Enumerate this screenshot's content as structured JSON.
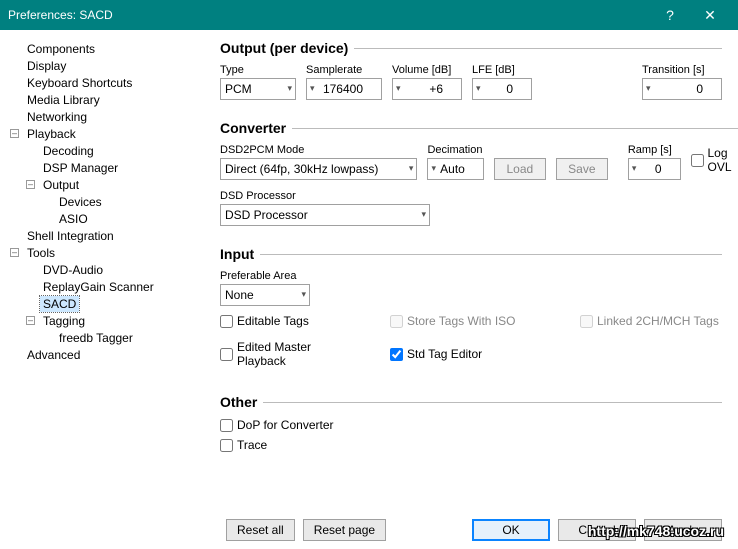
{
  "titlebar": {
    "title": "Preferences: SACD"
  },
  "tree": {
    "components": "Components",
    "display": "Display",
    "keyboard": "Keyboard Shortcuts",
    "media": "Media Library",
    "networking": "Networking",
    "playback": "Playback",
    "decoding": "Decoding",
    "dsp": "DSP Manager",
    "output": "Output",
    "devices": "Devices",
    "asio": "ASIO",
    "shell": "Shell Integration",
    "tools": "Tools",
    "dvda": "DVD-Audio",
    "rgs": "ReplayGain Scanner",
    "sacd": "SACD",
    "tagging": "Tagging",
    "freedb": "freedb Tagger",
    "advanced": "Advanced"
  },
  "sections": {
    "output": "Output (per device)",
    "converter": "Converter",
    "input": "Input",
    "other": "Other"
  },
  "output": {
    "type_label": "Type",
    "type_value": "PCM",
    "sr_label": "Samplerate",
    "sr_value": "176400",
    "vol_label": "Volume [dB]",
    "vol_value": "+6",
    "lfe_label": "LFE [dB]",
    "lfe_value": "0",
    "trans_label": "Transition [s]",
    "trans_value": "0"
  },
  "converter": {
    "mode_label": "DSD2PCM Mode",
    "mode_value": "Direct (64fp, 30kHz lowpass)",
    "dec_label": "Decimation",
    "dec_value": "Auto",
    "load": "Load",
    "save": "Save",
    "ramp_label": "Ramp [s]",
    "ramp_value": "0",
    "logovl": "Log OVL",
    "dsdproc_label": "DSD Processor",
    "dsdproc_value": "DSD Processor"
  },
  "input": {
    "area_label": "Preferable Area",
    "area_value": "None",
    "editable": "Editable Tags",
    "storeiso": "Store Tags With ISO",
    "linked": "Linked 2CH/MCH Tags",
    "edited": "Edited Master Playback",
    "stdtag": "Std Tag Editor"
  },
  "other": {
    "dop": "DoP for Converter",
    "trace": "Trace"
  },
  "buttons": {
    "reset_all": "Reset all",
    "reset_page": "Reset page",
    "ok": "OK",
    "cancel": "Cancel",
    "apply": "Apply"
  },
  "watermark": "http://mk748.ucoz.ru"
}
